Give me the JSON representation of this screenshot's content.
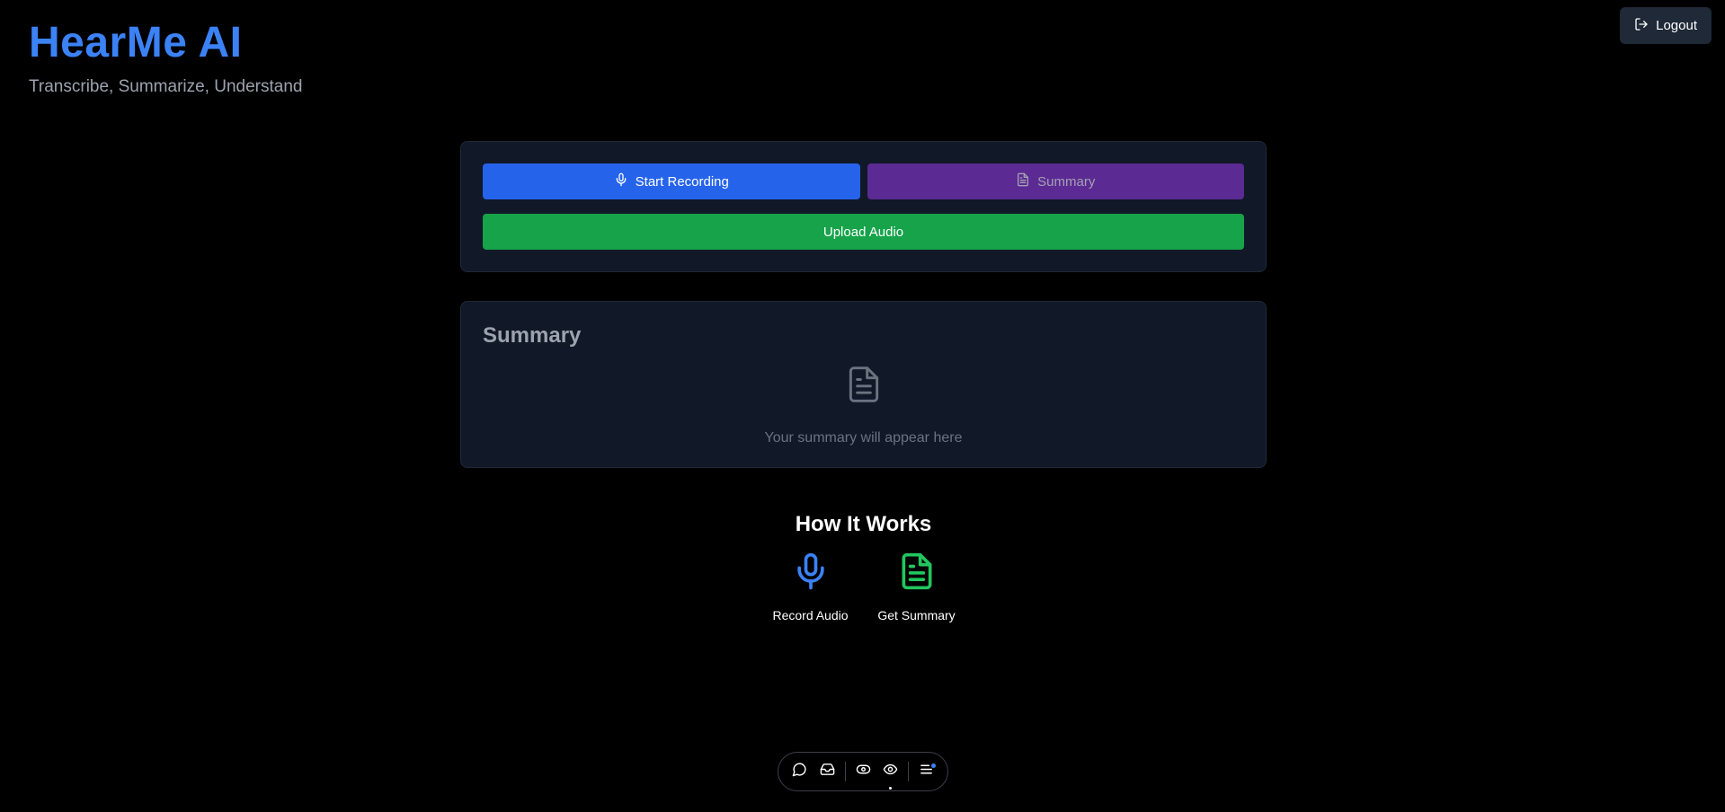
{
  "brand": {
    "title": "HearMe AI",
    "subtitle": "Transcribe, Summarize, Understand"
  },
  "header": {
    "logout_label": "Logout"
  },
  "controls": {
    "start_recording_label": "Start Recording",
    "summary_label": "Summary",
    "upload_audio_label": "Upload Audio"
  },
  "summary_panel": {
    "title": "Summary",
    "empty_text": "Your summary will appear here"
  },
  "how_it_works": {
    "title": "How It Works",
    "steps": [
      {
        "label": "Record Audio",
        "icon": "microphone-icon",
        "color": "#3b82f6"
      },
      {
        "label": "Get Summary",
        "icon": "document-icon",
        "color": "#22c55e"
      }
    ]
  },
  "dock": {
    "items": [
      "chat-icon",
      "inbox-icon",
      "toggle-icon",
      "eye-icon",
      "menu-icon"
    ]
  },
  "colors": {
    "background": "#000000",
    "accent_blue": "#2563eb",
    "summary_purple": "#5b2a93",
    "upload_green": "#16a34a",
    "card_bg": "#111827"
  }
}
